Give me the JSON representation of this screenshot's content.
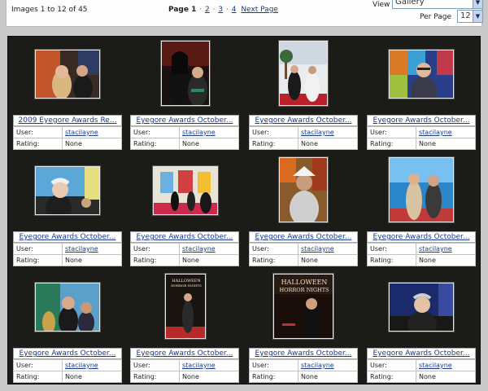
{
  "header": {
    "count_text": "Images 1 to 12 of 45",
    "page_label": "Page 1",
    "pages": [
      "2",
      "3",
      "4"
    ],
    "next_label": "Next Page",
    "view_label": "View",
    "view_value": "Gallery",
    "per_page_label": "Per Page",
    "per_page_value": "12"
  },
  "labels": {
    "user": "User:",
    "rating": "Rating:"
  },
  "items": [
    {
      "title": "2009 Eyegore Awards Re...",
      "user": "stacilayne",
      "rating": "None"
    },
    {
      "title": "Eyegore Awards October...",
      "user": "stacilayne",
      "rating": "None"
    },
    {
      "title": "Eyegore Awards October...",
      "user": "stacilayne",
      "rating": "None"
    },
    {
      "title": "Eyegore Awards October...",
      "user": "stacilayne",
      "rating": "None"
    },
    {
      "title": "Eyegore Awards October...",
      "user": "stacilayne",
      "rating": "None"
    },
    {
      "title": "Eyegore Awards October...",
      "user": "stacilayne",
      "rating": "None"
    },
    {
      "title": "Eyegore Awards October...",
      "user": "stacilayne",
      "rating": "None"
    },
    {
      "title": "Eyegore Awards October...",
      "user": "stacilayne",
      "rating": "None"
    },
    {
      "title": "Eyegore Awards October...",
      "user": "stacilayne",
      "rating": "None"
    },
    {
      "title": "Eyegore Awards October...",
      "user": "stacilayne",
      "rating": "None"
    },
    {
      "title": "Eyegore Awards October...",
      "user": "stacilayne",
      "rating": "None"
    },
    {
      "title": "Eyegore Awards October...",
      "user": "stacilayne",
      "rating": "None"
    }
  ],
  "photo_texts": {
    "hhn_line1": "HALLOWEEN",
    "hhn_line2": "HORROR NIGHTS"
  }
}
